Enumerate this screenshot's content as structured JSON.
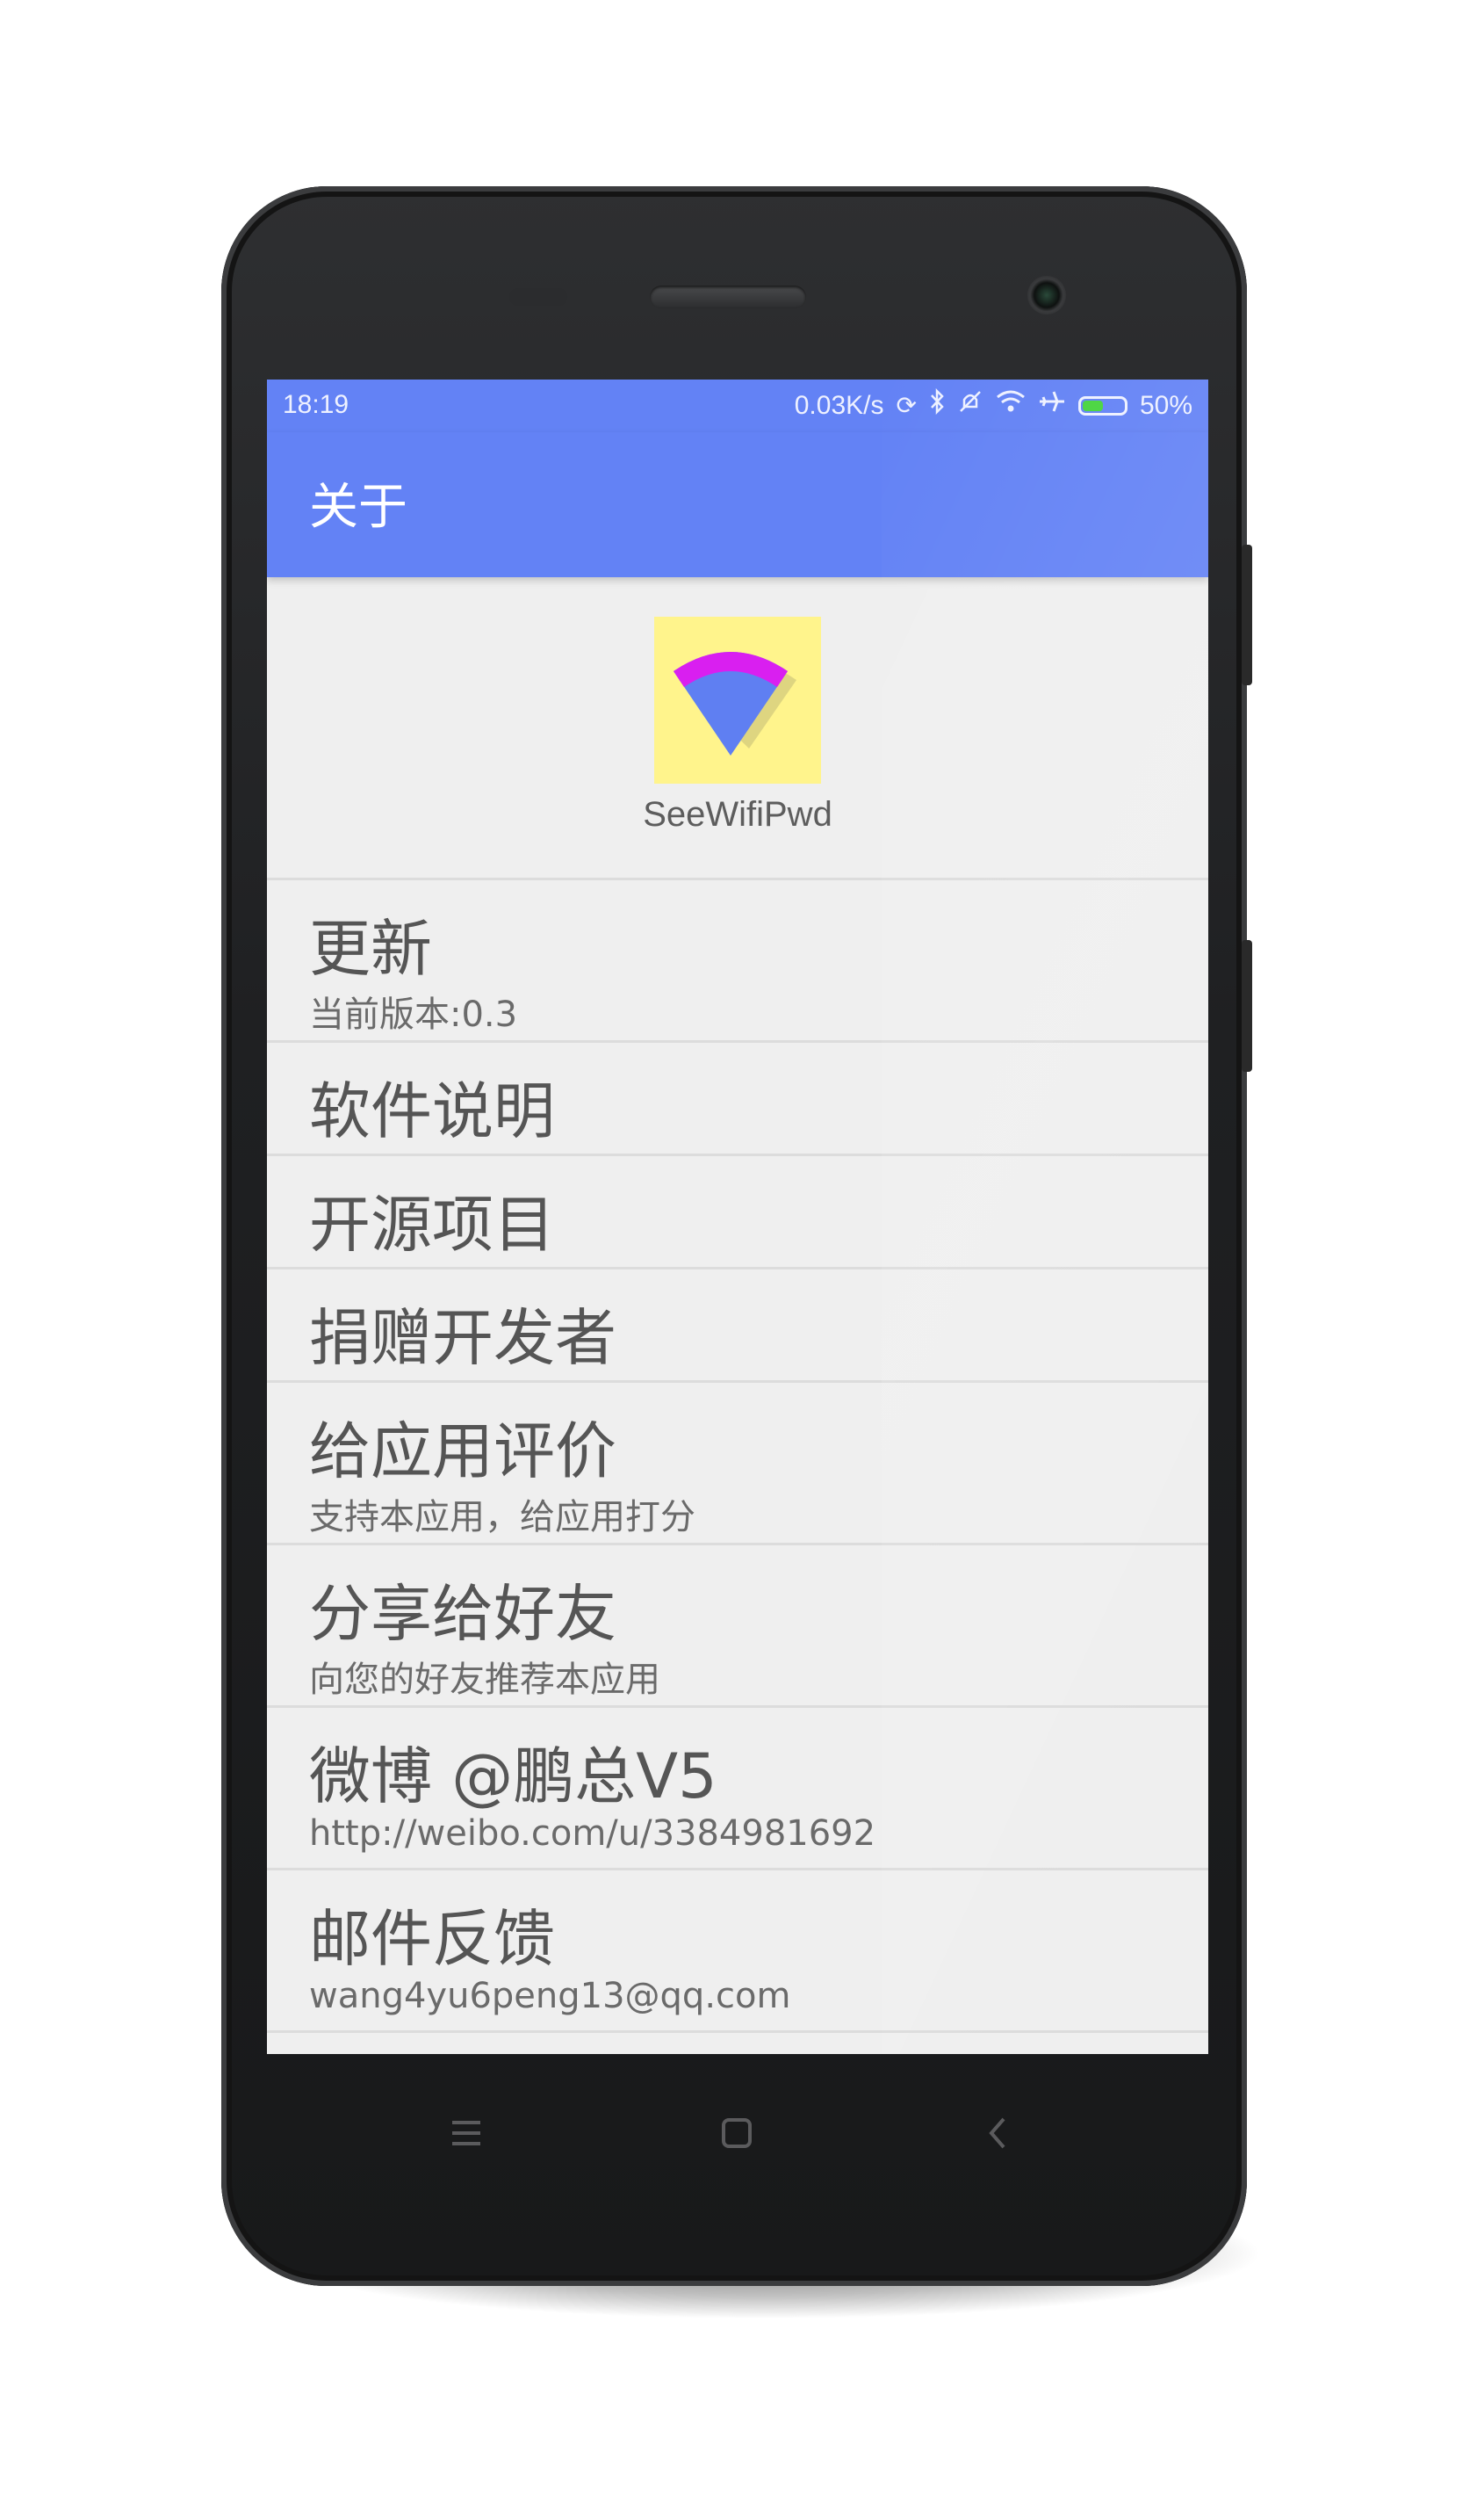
{
  "status_bar": {
    "time": "18:19",
    "network_speed": "0.03K/s",
    "battery": "50%",
    "battery_level": 0.5,
    "icons": [
      "sync-icon",
      "bluetooth-icon",
      "mute-icon",
      "wifi-icon",
      "airplane-icon",
      "battery-icon"
    ]
  },
  "app_bar": {
    "title": "关于"
  },
  "header": {
    "app_name": "SeeWifiPwd",
    "icon": "wifi-logo-icon"
  },
  "items": [
    {
      "title": "更新",
      "subtitle": "当前版本:0.3"
    },
    {
      "title": "软件说明",
      "subtitle": ""
    },
    {
      "title": "开源项目",
      "subtitle": ""
    },
    {
      "title": "捐赠开发者",
      "subtitle": ""
    },
    {
      "title": "给应用评价",
      "subtitle": "支持本应用，给应用打分"
    },
    {
      "title": "分享给好友",
      "subtitle": "向您的好友推荐本应用"
    },
    {
      "title": "微博 @鹏总V5",
      "subtitle": "http://weibo.com/u/3384981692"
    },
    {
      "title": "邮件反馈",
      "subtitle": "wang4yu6peng13@qq.com"
    }
  ],
  "nav": {
    "menu": "≡",
    "home": "▢",
    "back": "‹"
  },
  "colors": {
    "primary": "#6382f5",
    "background": "#efefef",
    "icon_bg": "#fff48c",
    "wifi_arc": "#d91ff0",
    "wifi_fan": "#5f7ff2"
  }
}
